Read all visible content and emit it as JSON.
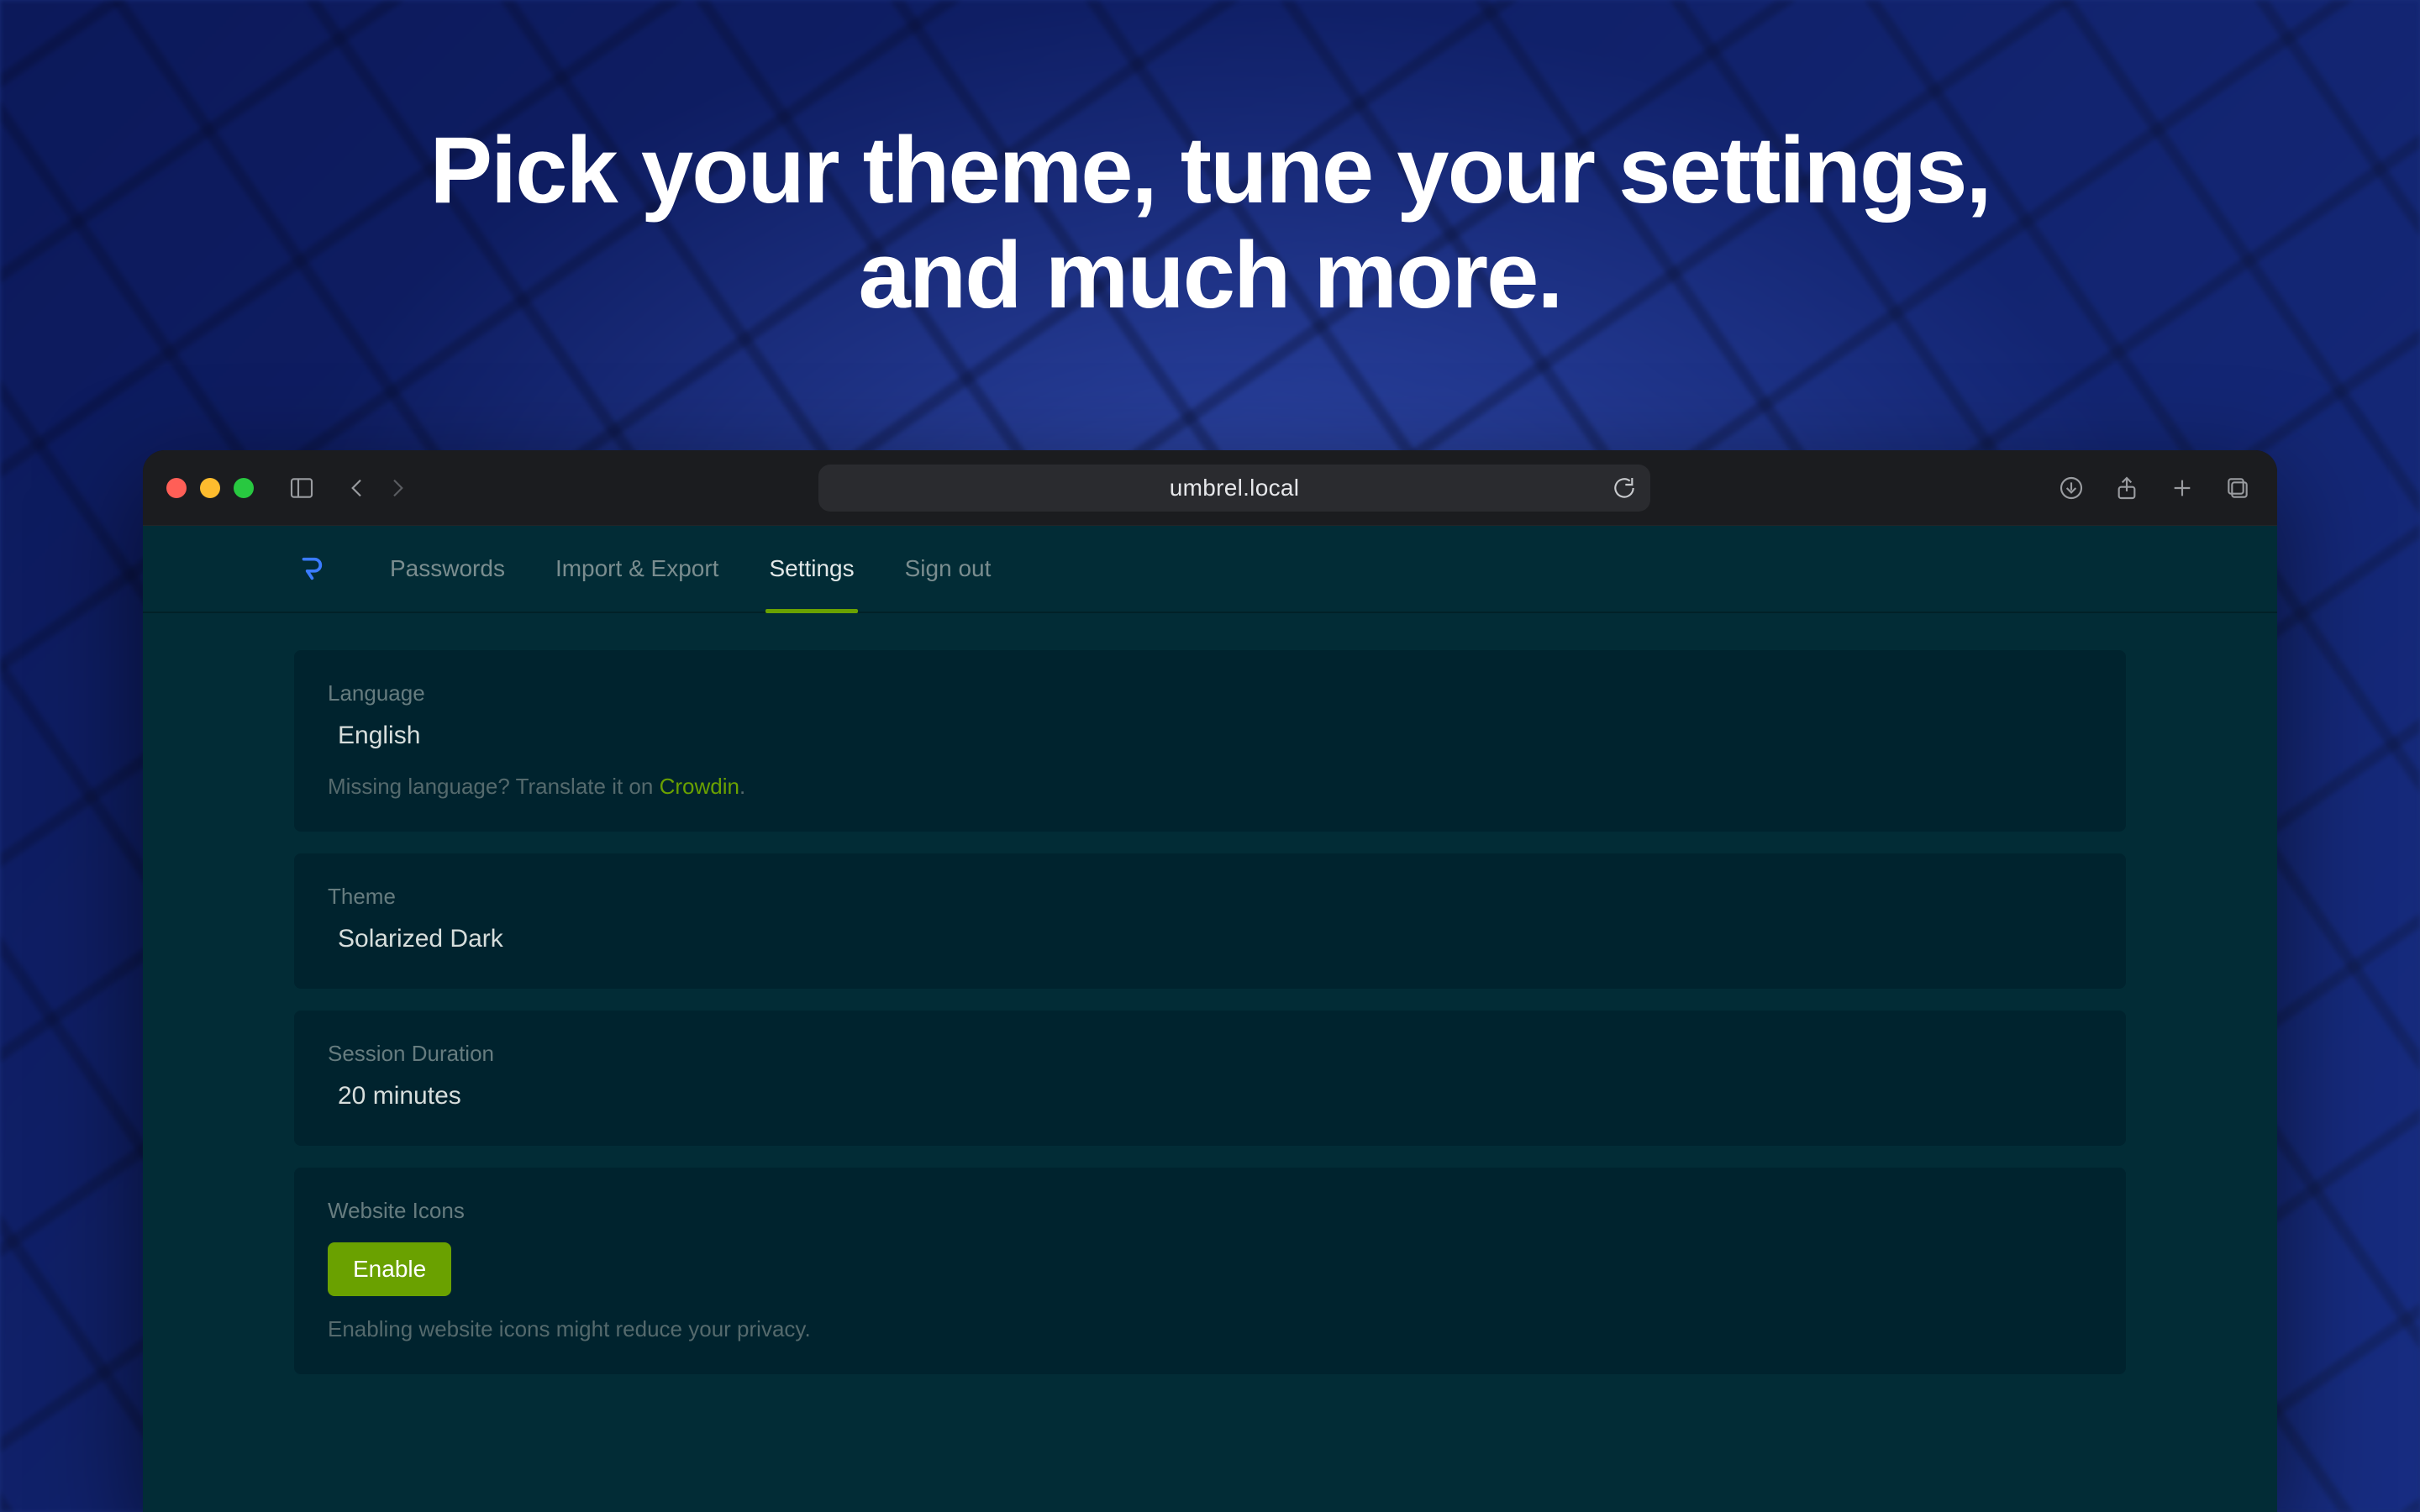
{
  "headline": {
    "line1": "Pick your theme, tune your settings,",
    "line2": "and much more."
  },
  "browser": {
    "url": "umbrel.local"
  },
  "nav": {
    "items": [
      {
        "label": "Passwords"
      },
      {
        "label": "Import & Export"
      },
      {
        "label": "Settings",
        "active": true
      },
      {
        "label": "Sign out"
      }
    ]
  },
  "cards": {
    "language": {
      "label": "Language",
      "value": "English",
      "help_before": "Missing language? Translate it on ",
      "help_link": "Crowdin",
      "help_after": "."
    },
    "theme": {
      "label": "Theme",
      "value": "Solarized Dark"
    },
    "session": {
      "label": "Session Duration",
      "value": "20 minutes"
    },
    "icons": {
      "label": "Website Icons",
      "button": "Enable",
      "help": "Enabling website icons might reduce your privacy."
    }
  }
}
